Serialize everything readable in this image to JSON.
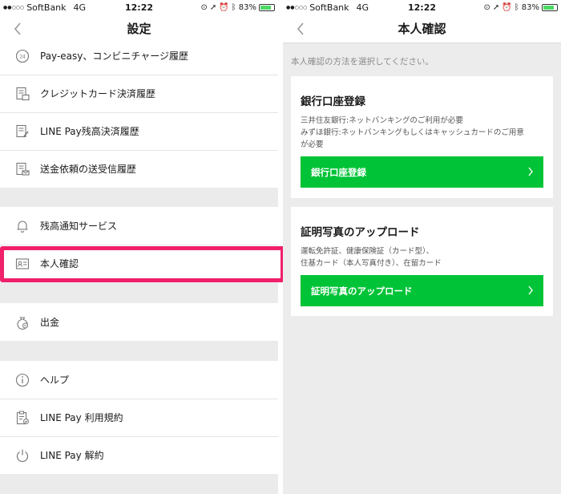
{
  "status_bar": {
    "carrier": "SoftBank",
    "network": "4G",
    "time": "12:22",
    "battery": "83%",
    "battery_level": 0.83,
    "battery_color": "#4cd964"
  },
  "left": {
    "title": "設定",
    "groups": [
      [
        {
          "label": "Pay-easy、コンビニチャージ履歴",
          "icon": "calendar-24-icon"
        },
        {
          "label": "クレジットカード決済履歴",
          "icon": "card-document-icon"
        },
        {
          "label": "LINE Pay残高決済履歴",
          "icon": "document-edit-icon"
        },
        {
          "label": "送金依頼の送受信履歴",
          "icon": "document-send-icon"
        }
      ],
      [
        {
          "label": "残高通知サービス",
          "icon": "bell-icon"
        },
        {
          "label": "本人確認",
          "icon": "id-card-icon"
        }
      ],
      [
        {
          "label": "出金",
          "icon": "money-bag-icon"
        }
      ],
      [
        {
          "label": "ヘルプ",
          "icon": "info-icon"
        },
        {
          "label": "LINE Pay 利用規約",
          "icon": "clipboard-icon"
        },
        {
          "label": "LINE Pay 解約",
          "icon": "power-icon"
        }
      ]
    ],
    "highlight_color": "#f0206b"
  },
  "right": {
    "title": "本人確認",
    "intro": "本人確認の方法を選択してください。",
    "bank_card": {
      "title": "銀行口座登録",
      "desc_lines": [
        "三井住友銀行:ネットバンキングのご利用が必要",
        "みずほ銀行:ネットバンキングもしくはキャッシュカードのご用意",
        "が必要"
      ],
      "button": "銀行口座登録"
    },
    "photo_card": {
      "title": "証明写真のアップロード",
      "desc_lines": [
        "運転免許証、健康保険証（カード型）、",
        "住基カード（本人写真付き）、在留カード"
      ],
      "button": "証明写真のアップロード"
    },
    "accent_color": "#00c337"
  }
}
